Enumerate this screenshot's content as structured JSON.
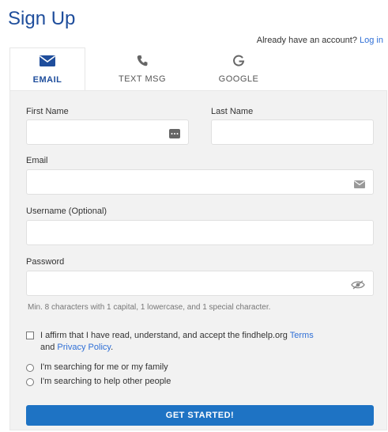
{
  "page": {
    "title": "Sign Up"
  },
  "login": {
    "prompt": "Already have an account?",
    "link": "Log in"
  },
  "tabs": [
    {
      "label": "EMAIL",
      "icon": "envelope-icon",
      "active": true
    },
    {
      "label": "TEXT MSG",
      "icon": "phone-icon",
      "active": false
    },
    {
      "label": "GOOGLE",
      "icon": "google-g-icon",
      "active": false
    }
  ],
  "form": {
    "first_name": {
      "label": "First Name",
      "value": "",
      "icon": "contact-card-icon"
    },
    "last_name": {
      "label": "Last Name",
      "value": ""
    },
    "email": {
      "label": "Email",
      "value": "",
      "icon": "envelope-icon"
    },
    "username": {
      "label": "Username (Optional)",
      "value": ""
    },
    "password": {
      "label": "Password",
      "value": "",
      "icon": "eye-slash-icon"
    },
    "password_hint": "Min. 8 characters with 1 capital, 1 lowercase, and 1 special character.",
    "affirm": {
      "prefix": "I affirm that I have read, understand, and accept the findhelp.org",
      "terms_link": "Terms",
      "and": "and",
      "privacy_link": "Privacy Policy",
      "suffix": ".",
      "checked": false
    },
    "radios": [
      {
        "label": "I'm searching for me or my family",
        "selected": false
      },
      {
        "label": "I'm searching to help other people",
        "selected": false
      }
    ],
    "submit_label": "GET STARTED!"
  },
  "colors": {
    "brand": "#1f4e9c",
    "link": "#2f6fd6",
    "button": "#1e73c4",
    "panel": "#f2f2f2"
  }
}
